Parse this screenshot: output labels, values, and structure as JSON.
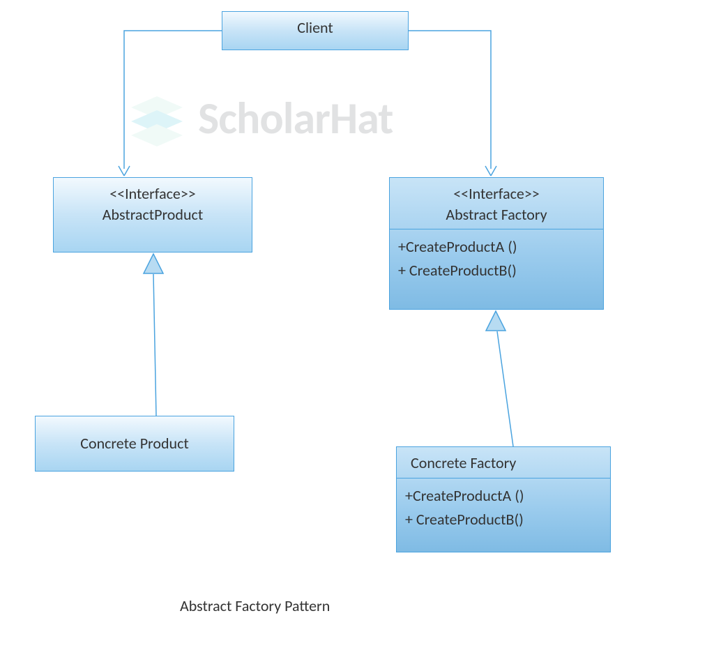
{
  "title": "Abstract Factory Pattern",
  "watermark": "ScholarHat",
  "boxes": {
    "client": {
      "label": "Client"
    },
    "abstract_product": {
      "stereotype": "<<Interface>>",
      "name": "AbstractProduct"
    },
    "abstract_factory": {
      "stereotype": "<<Interface>>",
      "name": "Abstract Factory",
      "methods": [
        "+CreateProductA ()",
        "+ CreateProductB()"
      ]
    },
    "concrete_product": {
      "name": "Concrete Product"
    },
    "concrete_factory": {
      "name": "Concrete Factory",
      "methods": [
        "+CreateProductA ()",
        "+ CreateProductB()"
      ]
    }
  },
  "relations": [
    {
      "from": "client",
      "to": "abstract_product",
      "type": "dependency-open-arrow"
    },
    {
      "from": "client",
      "to": "abstract_factory",
      "type": "dependency-open-arrow"
    },
    {
      "from": "concrete_product",
      "to": "abstract_product",
      "type": "generalization-hollow-triangle"
    },
    {
      "from": "concrete_factory",
      "to": "abstract_factory",
      "type": "generalization-hollow-triangle"
    }
  ]
}
